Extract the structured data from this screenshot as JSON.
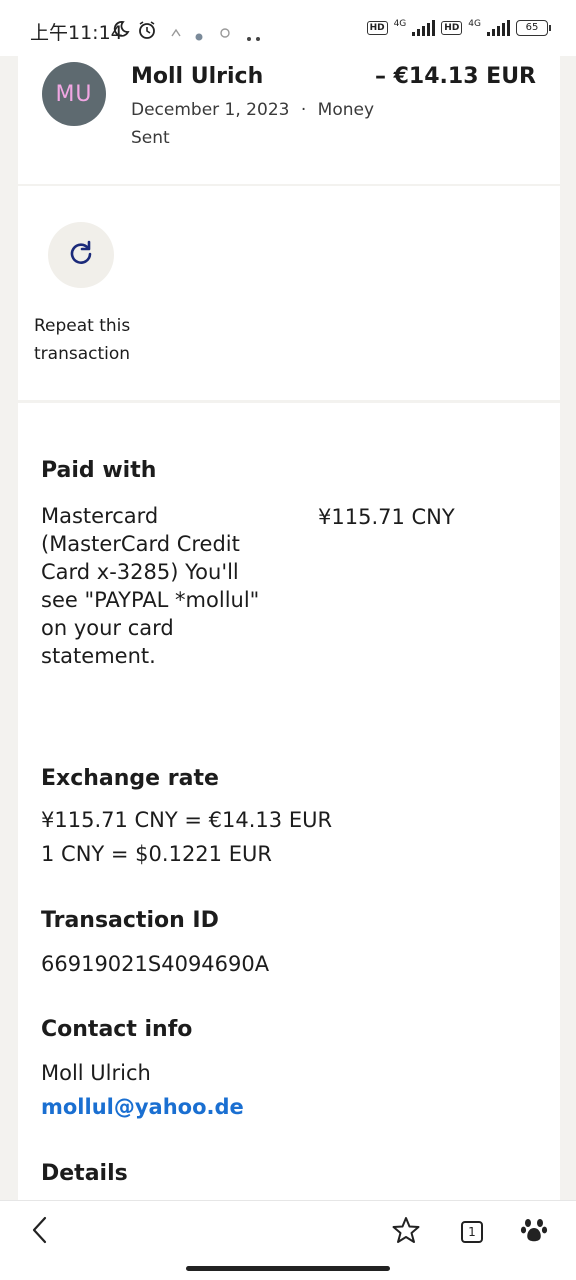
{
  "status_bar": {
    "time": "上午11:14",
    "network_1": "4G",
    "network_2": "4G",
    "hd_label": "HD",
    "battery": "65"
  },
  "header": {
    "avatar_initials": "MU",
    "name": "Moll Ulrich",
    "amount": "– €14.13 EUR",
    "date": "December 1, 2023",
    "separator": "·",
    "type": "Money Sent"
  },
  "actions": {
    "repeat_label": "Repeat this transaction"
  },
  "paid_with": {
    "title": "Paid with",
    "description": "Mastercard (MasterCard Credit Card x-3285) You'll see \"PAYPAL *mollul\" on your card statement.",
    "amount": "¥115.71 CNY"
  },
  "exchange_rate": {
    "title": "Exchange rate",
    "line1": "¥115.71 CNY = €14.13 EUR",
    "line2": "1 CNY = $0.1221 EUR"
  },
  "transaction_id": {
    "title": "Transaction ID",
    "value": "66919021S4094690A"
  },
  "contact_info": {
    "title": "Contact info",
    "name": "Moll Ulrich",
    "email": "mollul@yahoo.de"
  },
  "details": {
    "title": "Details"
  },
  "bottom_nav": {
    "tab_count": "1"
  }
}
